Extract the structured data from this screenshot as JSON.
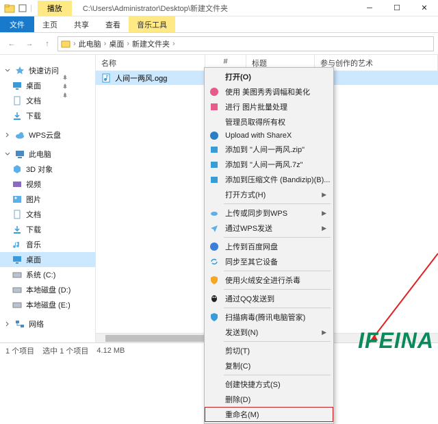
{
  "title": {
    "playback_tab": "播放",
    "path": "C:\\Users\\Administrator\\Desktop\\新建文件夹"
  },
  "menu": {
    "file": "文件",
    "home": "主页",
    "share": "共享",
    "view": "查看",
    "music": "音乐工具"
  },
  "breadcrumb": {
    "pc": "此电脑",
    "desktop": "桌面",
    "folder": "新建文件夹"
  },
  "columns": {
    "name": "名称",
    "num": "#",
    "title": "标题",
    "artist": "参与创作的艺术"
  },
  "file": {
    "name": "人间一两风.ogg"
  },
  "nav": {
    "quick": "快速访问",
    "desktop": "桌面",
    "docs": "文档",
    "downloads": "下载",
    "wps": "WPS云盘",
    "pc": "此电脑",
    "obj3d": "3D 对象",
    "videos": "视频",
    "pics": "图片",
    "docs2": "文档",
    "downloads2": "下载",
    "music": "音乐",
    "desktop2": "桌面",
    "sysc": "系统 (C:)",
    "diskd": "本地磁盘 (D:)",
    "diske": "本地磁盘 (E:)",
    "network": "网络"
  },
  "context_menu": {
    "open": "打开(O)",
    "meitu": "使用 美图秀秀调幅和美化",
    "batch": "进行 图片批量处理",
    "admin": "管理员取得所有权",
    "sharex": "Upload with ShareX",
    "addzip": "添加到 \"人间一两风.zip\"",
    "add7z": "添加到 \"人间一两风.7z\"",
    "addbandi": "添加到压缩文件 (Bandizip)(B)...",
    "openwith": "打开方式(H)",
    "wps_sync": "上传或同步到WPS",
    "wps_send": "通过WPS发送",
    "baidu": "上传到百度网盘",
    "sync_dev": "同步至其它设备",
    "huorong": "使用火绒安全进行杀毒",
    "qq": "通过QQ发送到",
    "tencent": "扫描病毒(腾讯电脑管家)",
    "sendto": "发送到(N)",
    "cut": "剪切(T)",
    "copy": "复制(C)",
    "shortcut": "创建快捷方式(S)",
    "delete": "删除(D)",
    "rename": "重命名(M)"
  },
  "status": {
    "count": "1 个项目",
    "selected": "选中 1 个项目",
    "size": "4.12 MB"
  },
  "watermark": "IFEINA"
}
